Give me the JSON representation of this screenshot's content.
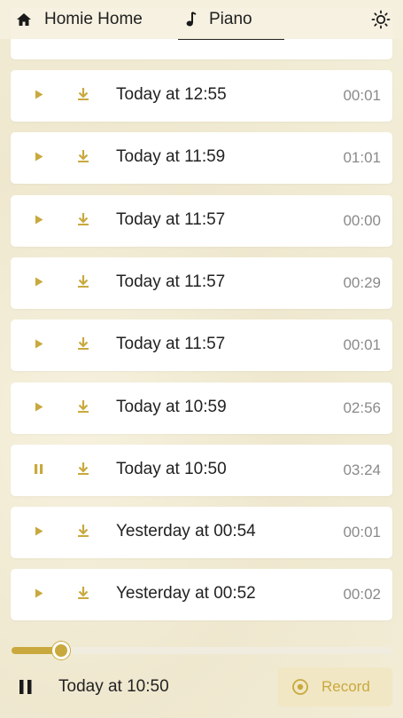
{
  "header": {
    "home_label": "Homie Home",
    "piano_label": "Piano"
  },
  "recordings": [
    {
      "title": "Today at 12:55",
      "duration": "00:01",
      "state": "play"
    },
    {
      "title": "Today at 11:59",
      "duration": "01:01",
      "state": "play"
    },
    {
      "title": "Today at 11:57",
      "duration": "00:00",
      "state": "play"
    },
    {
      "title": "Today at 11:57",
      "duration": "00:29",
      "state": "play"
    },
    {
      "title": "Today at 11:57",
      "duration": "00:01",
      "state": "play"
    },
    {
      "title": "Today at 10:59",
      "duration": "02:56",
      "state": "play"
    },
    {
      "title": "Today at 10:50",
      "duration": "03:24",
      "state": "pause"
    },
    {
      "title": "Yesterday at 00:54",
      "duration": "00:01",
      "state": "play"
    },
    {
      "title": "Yesterday at 00:52",
      "duration": "00:02",
      "state": "play"
    }
  ],
  "player": {
    "now_playing": "Today at 10:50",
    "progress": 0.13,
    "record_label": "Record"
  },
  "colors": {
    "accent": "#c9a93e",
    "record_bg": "#f1e7c4",
    "background": "#efe8cf"
  },
  "icons": {
    "home": "home-icon",
    "piano": "music-note-icon",
    "theme": "sun-icon",
    "play": "play-icon",
    "pause": "pause-icon",
    "download": "download-icon",
    "record": "record-icon"
  }
}
